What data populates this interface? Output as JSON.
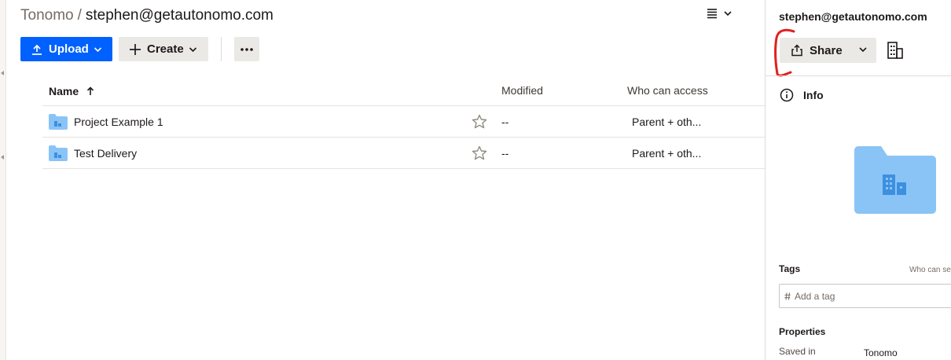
{
  "breadcrumb": {
    "root": "Tonomo",
    "separator": "/",
    "current": "stephen@getautonomo.com"
  },
  "toolbar": {
    "upload_label": "Upload",
    "create_label": "Create"
  },
  "table": {
    "columns": {
      "name": "Name",
      "modified": "Modified",
      "access": "Who can access"
    },
    "rows": [
      {
        "name": "Project Example 1",
        "modified": "--",
        "access": "Parent + oth..."
      },
      {
        "name": "Test Delivery",
        "modified": "--",
        "access": "Parent + oth..."
      }
    ]
  },
  "sidebar": {
    "title": "stephen@getautonomo.com",
    "share_label": "Share",
    "info_label": "Info",
    "tags_label": "Tags",
    "who_can_see": "Who can se",
    "tag_placeholder": "Add a tag",
    "properties_label": "Properties",
    "saved_in_key": "Saved in",
    "saved_in_value": "Tonomo"
  },
  "colors": {
    "primary": "#0061fe",
    "folder": "#8ac4f7",
    "annotation": "#e02020"
  },
  "icons": [
    "upload-icon",
    "plus-icon",
    "more-icon",
    "list-view-icon",
    "sort-up-icon",
    "folder-icon",
    "star-icon",
    "share-icon",
    "building-icon",
    "info-icon",
    "hash-icon"
  ]
}
